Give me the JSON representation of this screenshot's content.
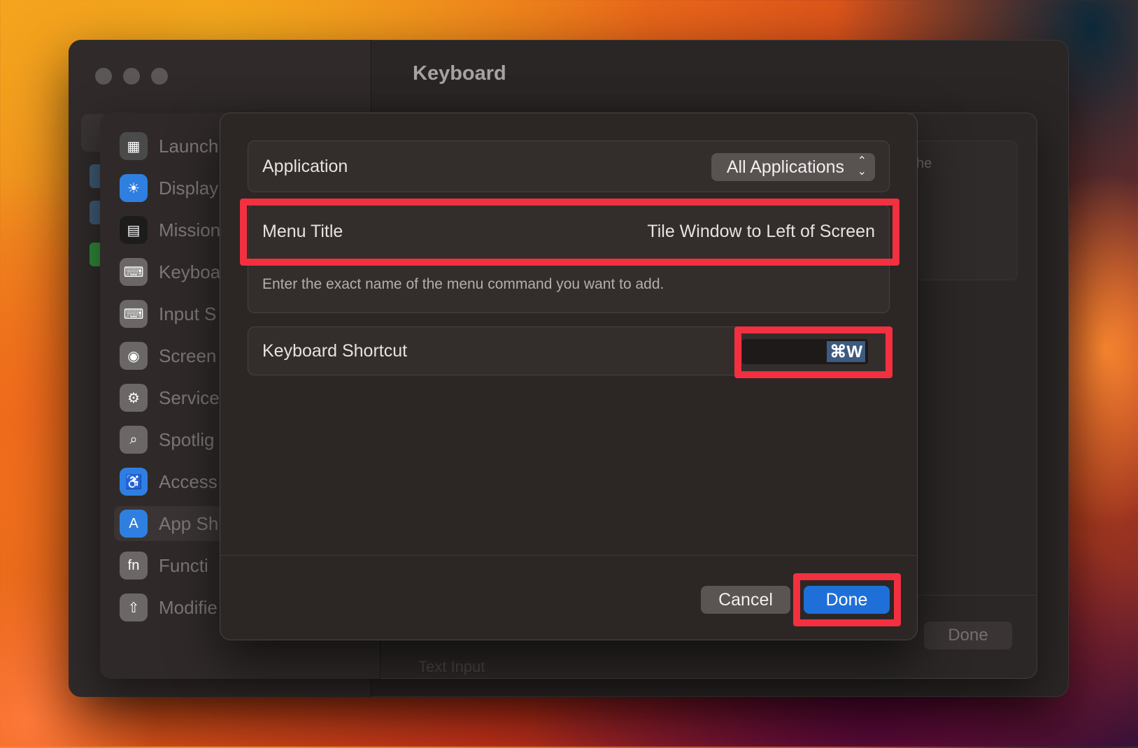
{
  "window": {
    "title": "Keyboard"
  },
  "sidebar": {
    "items": [
      {
        "label": "Launch",
        "icon": "launchpad-icon",
        "color": "#4a4a4a"
      },
      {
        "label": "Display",
        "icon": "sun-icon",
        "color": "#2f7fe0"
      },
      {
        "label": "Mission",
        "icon": "mission-control-icon",
        "color": "#1c1c1c"
      },
      {
        "label": "Keyboa",
        "icon": "keyboard-icon",
        "color": "#6b6766"
      },
      {
        "label": "Input S",
        "icon": "keyboard-icon",
        "color": "#6b6766"
      },
      {
        "label": "Screen",
        "icon": "screenshot-icon",
        "color": "#6b6766"
      },
      {
        "label": "Service",
        "icon": "gears-icon",
        "color": "#6b6766"
      },
      {
        "label": "Spotlig",
        "icon": "magnifier-icon",
        "color": "#6b6766"
      },
      {
        "label": "Access",
        "icon": "accessibility-icon",
        "color": "#2f7fe0"
      },
      {
        "label": "App Sh",
        "icon": "app-store-icon",
        "color": "#2f7fe0",
        "selected": true
      },
      {
        "label": "Functi",
        "icon": "fn-icon",
        "color": "#6b6766"
      },
      {
        "label": "Modifie",
        "icon": "shift-arrow-icon",
        "color": "#6b6766"
      }
    ]
  },
  "background": {
    "panel_text": "he",
    "done_label": "Done",
    "bottom_text": "Text Input"
  },
  "dialog": {
    "application": {
      "label": "Application",
      "value": "All Applications"
    },
    "menu_title": {
      "label": "Menu Title",
      "value": "Tile Window to Left of Screen",
      "hint": "Enter the exact name of the menu command you want to add."
    },
    "shortcut": {
      "label": "Keyboard Shortcut",
      "value": "⌘W"
    },
    "buttons": {
      "cancel": "Cancel",
      "done": "Done"
    }
  },
  "colors": {
    "accent": "#1f6fd8",
    "highlight": "#f2303f",
    "selection": "#3d5a80"
  }
}
